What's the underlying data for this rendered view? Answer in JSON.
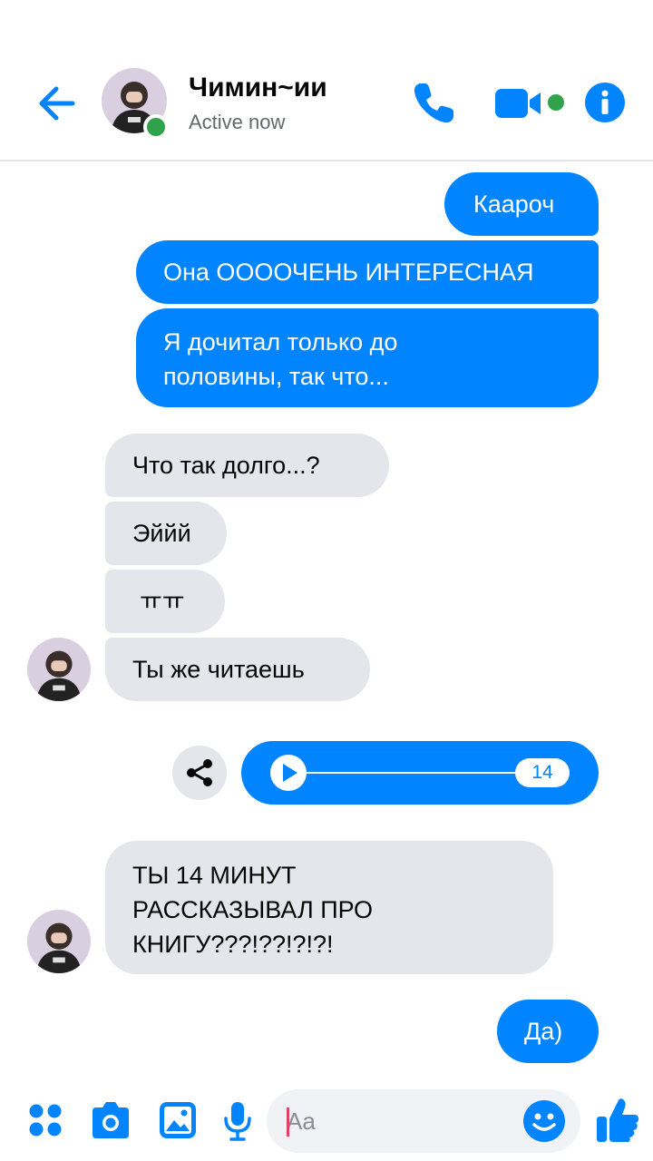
{
  "header": {
    "contact_name": "Чимин~ии",
    "status": "Active now"
  },
  "messages": {
    "m1": "Кааpоч",
    "m2": "Она ООООЧЕНЬ ИНТЕРЕСНАЯ",
    "m3_line1": "Я дочитал только до",
    "m3_line2": "половины, так что...",
    "m4": "Что так долго...?",
    "m5": "Эййй",
    "m6": "ㅠㅠ",
    "m7": "Ты же читаешь",
    "voice_duration": "14",
    "m9_line1": "ТЫ 14 МИНУТ",
    "m9_line2": "РАССКАЗЫВАЛ ПРО",
    "m9_line3": "КНИГУ???!??!?!?!",
    "m10": "Да)"
  },
  "composer": {
    "placeholder": "Aa"
  },
  "colors": {
    "accent": "#0084ff",
    "incoming_bubble": "#e4e6eb",
    "online": "#31a24c"
  },
  "icons": {
    "back": "arrow-left-icon",
    "call": "phone-icon",
    "video": "video-camera-icon",
    "info": "info-icon",
    "share": "share-icon",
    "play": "play-icon",
    "more": "four-dots-icon",
    "camera": "camera-icon",
    "gallery": "image-icon",
    "mic": "microphone-icon",
    "emoji": "smile-icon",
    "like": "thumbs-up-icon"
  }
}
